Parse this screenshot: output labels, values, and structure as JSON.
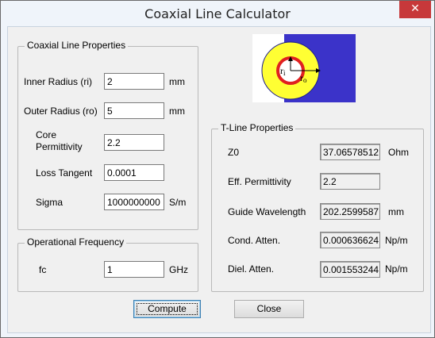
{
  "window": {
    "title": "Coaxial Line Calculator",
    "close_glyph": "✕"
  },
  "coax_props": {
    "legend": "Coaxial Line Properties",
    "inner_radius": {
      "label": "Inner Radius (ri)",
      "value": "2",
      "unit": "mm"
    },
    "outer_radius": {
      "label": "Outer Radius (ro)",
      "value": "5",
      "unit": "mm"
    },
    "core_permittivity": {
      "label": "Core Permittivity",
      "value": "2.2"
    },
    "loss_tangent": {
      "label": "Loss Tangent",
      "value": "0.0001"
    },
    "sigma": {
      "label": "Sigma",
      "value": "1000000000",
      "unit": "S/m"
    }
  },
  "op_freq": {
    "legend": "Operational Frequency",
    "fc": {
      "label": "fc",
      "value": "1",
      "unit": "GHz"
    }
  },
  "diagram": {
    "ri_label": "r",
    "ri_sub": "i",
    "ro_label": "r",
    "ro_sub": "o"
  },
  "tline": {
    "legend": "T-Line Properties",
    "z0": {
      "label": "Z0",
      "value": "37.06578512",
      "unit": "Ohm"
    },
    "eff_perm": {
      "label": "Eff. Permittivity",
      "value": "2.2"
    },
    "guide_wl": {
      "label": "Guide Wavelength",
      "value": "202.2599587",
      "unit": "mm"
    },
    "cond_atten": {
      "label": "Cond. Atten.",
      "value": "0.000636624",
      "unit": "Np/m"
    },
    "diel_atten": {
      "label": "Diel. Atten.",
      "value": "0.001553244",
      "unit": "Np/m"
    }
  },
  "buttons": {
    "compute": "Compute",
    "close": "Close"
  },
  "colors": {
    "outer_conductor": "#3b33c9",
    "dielectric": "#ffff33",
    "inner_conductor": "#e02020",
    "close_button": "#c7383a"
  }
}
